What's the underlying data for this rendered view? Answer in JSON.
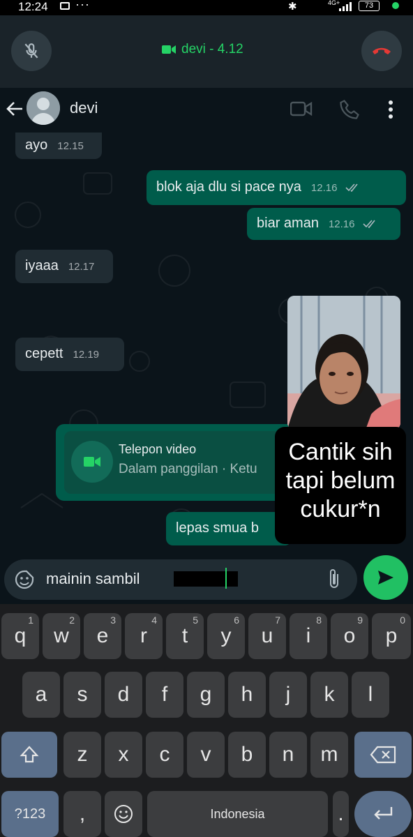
{
  "status_bar": {
    "time": "12:24",
    "network": "4G+",
    "battery": "73"
  },
  "call_bar": {
    "title": "devi - 4.12",
    "mute_icon": "mic-off-icon",
    "end_icon": "call-end-icon",
    "accent": "#25d366"
  },
  "header": {
    "contact_name": "devi"
  },
  "messages": [
    {
      "text": "ayo",
      "time": "12.15",
      "dir": "in"
    },
    {
      "text": "blok aja dlu si pace nya",
      "time": "12.16",
      "dir": "out"
    },
    {
      "text": "biar aman",
      "time": "12.16",
      "dir": "out"
    },
    {
      "text": "iyaaa",
      "time": "12.17",
      "dir": "in"
    },
    {
      "text": "cepett",
      "time": "12.19",
      "dir": "in"
    },
    {
      "text": "lepas smua b",
      "time": "",
      "dir": "out"
    }
  ],
  "call_card": {
    "title": "Telepon video",
    "subtitle": "Dalam panggilan · Ketu"
  },
  "caption": {
    "line1": "Cantik sih",
    "line2": "tapi belum",
    "line3": "cukur*n"
  },
  "input": {
    "value": "mainin sambil"
  },
  "keyboard": {
    "row1": [
      [
        "q",
        "1"
      ],
      [
        "w",
        "2"
      ],
      [
        "e",
        "3"
      ],
      [
        "r",
        "4"
      ],
      [
        "t",
        "5"
      ],
      [
        "y",
        "6"
      ],
      [
        "u",
        "7"
      ],
      [
        "i",
        "8"
      ],
      [
        "o",
        "9"
      ],
      [
        "p",
        "0"
      ]
    ],
    "row2": [
      "a",
      "s",
      "d",
      "f",
      "g",
      "h",
      "j",
      "k",
      "l"
    ],
    "row3": [
      "z",
      "x",
      "c",
      "v",
      "b",
      "n",
      "m"
    ],
    "mode_key": "?123",
    "comma_key": ",",
    "space_label": "Indonesia",
    "period_key": "."
  },
  "colors": {
    "bg": "#0b141a",
    "incoming": "#202c33",
    "outgoing": "#005c4b",
    "send": "#21c063"
  }
}
